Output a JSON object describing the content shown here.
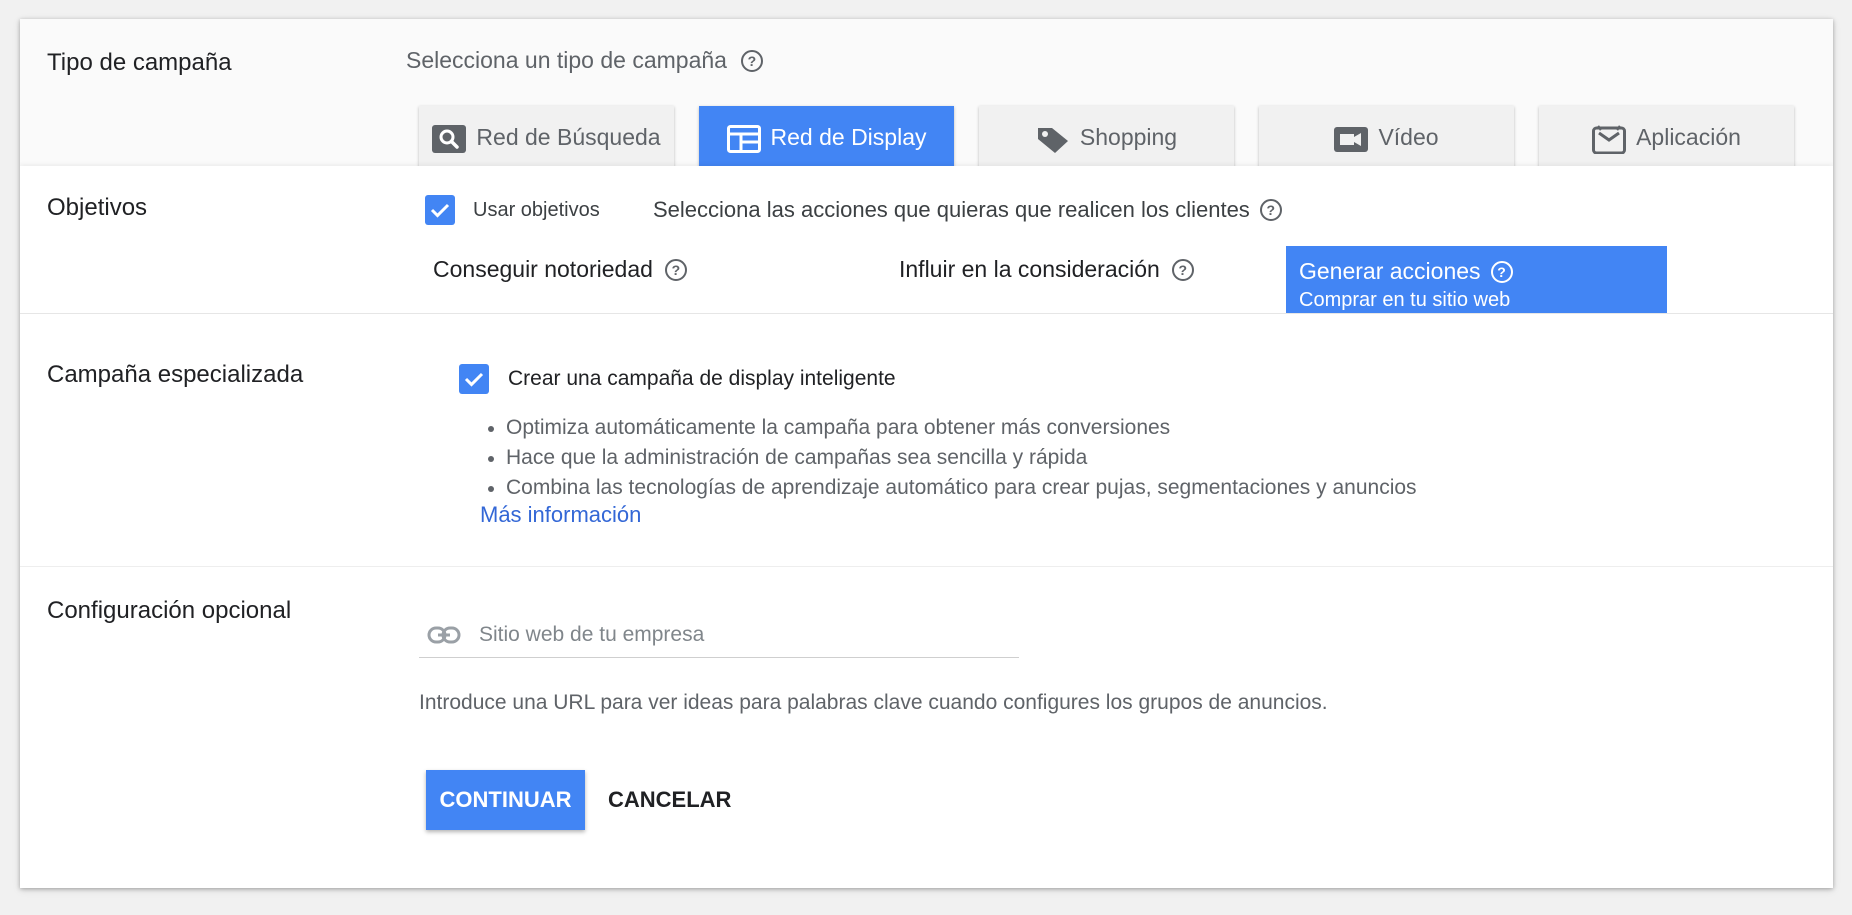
{
  "campaign_type": {
    "title": "Tipo de campaña",
    "subtitle": "Selecciona un tipo de campaña",
    "tabs": [
      {
        "label": "Red de Búsqueda",
        "icon": "search-icon",
        "selected": false
      },
      {
        "label": "Red de Display",
        "icon": "display-icon",
        "selected": true
      },
      {
        "label": "Shopping",
        "icon": "tag-icon",
        "selected": false
      },
      {
        "label": "Vídeo",
        "icon": "video-icon",
        "selected": false
      },
      {
        "label": "Aplicación",
        "icon": "app-icon",
        "selected": false
      }
    ]
  },
  "objectives": {
    "title": "Objetivos",
    "use_label": "Usar objetivos",
    "use_checked": true,
    "description": "Selecciona las acciones que quieras que realicen los clientes",
    "goals": [
      {
        "label": "Conseguir notoriedad"
      },
      {
        "label": "Influir en la consideración"
      }
    ],
    "selected_goal": {
      "label": "Generar acciones",
      "sub": "Comprar en tu sitio web"
    }
  },
  "specialized": {
    "title": "Campaña especializada",
    "checkbox_label": "Crear una campaña de display inteligente",
    "checked": true,
    "bullets": [
      "Optimiza automáticamente la campaña para obtener más conversiones",
      "Hace que la administración de campañas sea sencilla y rápida",
      "Combina las tecnologías de aprendizaje automático para crear pujas, segmentaciones y anuncios"
    ],
    "more_link": "Más información"
  },
  "optional": {
    "title": "Configuración opcional",
    "url_placeholder": "Sitio web de tu empresa",
    "url_value": "",
    "hint": "Introduce una URL para ver ideas para palabras clave cuando configures los grupos de anuncios."
  },
  "actions": {
    "continue": "CONTINUAR",
    "cancel": "CANCELAR"
  },
  "colors": {
    "accent": "#4285f4",
    "link": "#3367d6"
  }
}
